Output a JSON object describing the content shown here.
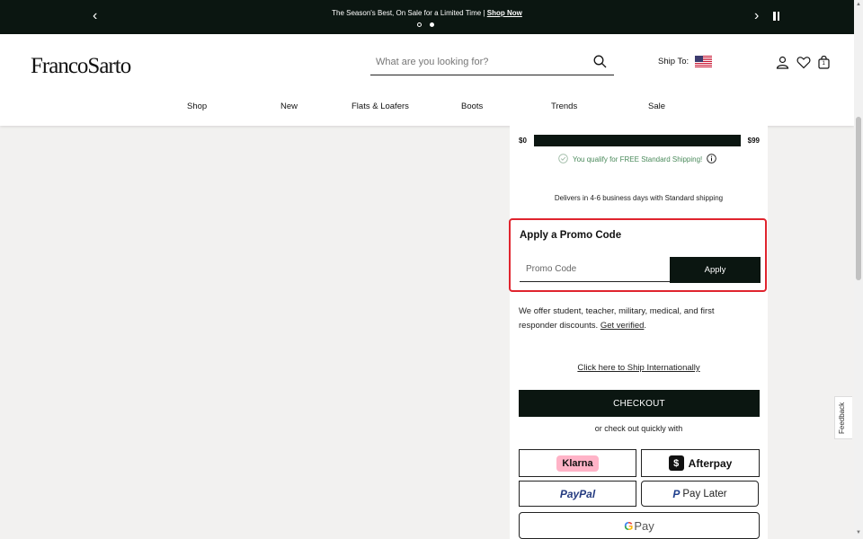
{
  "promo_bar": {
    "text": "The Season's Best, On Sale for a Limited Time |",
    "link": "Shop Now",
    "prev_icon": "chevron-left-icon",
    "next_icon": "chevron-right-icon",
    "pause_icon": "pause-icon",
    "slide_count": 2,
    "active_slide": 2
  },
  "header": {
    "logo": "FrancoSarto",
    "search": {
      "placeholder": "What are you looking for?",
      "value": ""
    },
    "ship_to_label": "Ship To:",
    "icons": [
      "account-icon",
      "heart-icon",
      "bag-icon"
    ],
    "bag_count": "1"
  },
  "nav": {
    "items": [
      {
        "label": "Shop"
      },
      {
        "label": "New"
      },
      {
        "label": "Flats & Loafers"
      },
      {
        "label": "Boots"
      },
      {
        "label": "Trends"
      },
      {
        "label": "Sale"
      }
    ]
  },
  "shipping": {
    "min": "$0",
    "max": "$99",
    "progress": 1.0,
    "qualify_text": "You qualify for FREE Standard Shipping!",
    "delivers_text": "Delivers in 4-6 business days with Standard shipping"
  },
  "promo": {
    "title": "Apply a Promo Code",
    "placeholder": "Promo Code",
    "value": "",
    "apply_label": "Apply"
  },
  "discount": {
    "text": "We offer student, teacher, military, medical, and first responder discounts.",
    "link": "Get verified",
    "suffix": "."
  },
  "intl_link": "Click here to Ship Internationally",
  "checkout_label": "CHECKOUT",
  "or_quick": "or check out quickly with",
  "payments": {
    "klarna": "Klarna",
    "afterpay": "Afterpay",
    "paypal": "PayPal",
    "paylater_brand": "P",
    "paylater": "Pay Later",
    "gpay_g": "G",
    "gpay": "Pay"
  },
  "feedback": "Feedback",
  "colors": {
    "dark": "#0b1611",
    "promo_border": "#e0242e",
    "qualify_green": "#4a8a5b",
    "klarna_pink": "#ffb3c7"
  }
}
